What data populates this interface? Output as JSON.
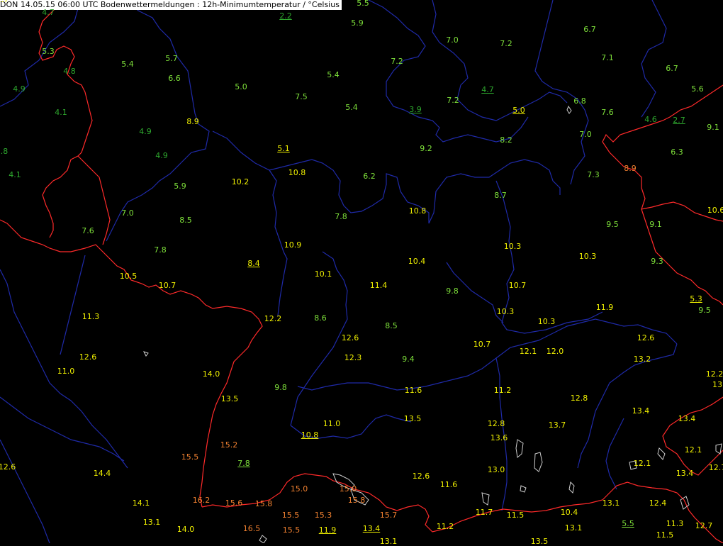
{
  "title": "DON 14.05.15 06:00 UTC  Bodenwettermeldungen :  12h-Minimumtemperatur / °Celsius",
  "colors": {
    "background": "#000000",
    "country_border": "#ff2a2a",
    "state_border": "#1f2aa8",
    "lake_outline": "#cfcfcf",
    "cold_dark": "#2ea82e",
    "cool": "#7ee03a",
    "mild": "#f0f000",
    "warm": "#f08030"
  },
  "stations": [
    {
      "v": "4.7",
      "cls": "cold_dark"
    },
    {
      "v": "5.5",
      "cls": "cool"
    },
    {
      "v": "2.2",
      "cls": "cold_dark",
      "u": true
    },
    {
      "v": "5.9",
      "cls": "cool"
    },
    {
      "v": "6.7",
      "cls": "cool"
    },
    {
      "v": "7.0",
      "cls": "cool"
    },
    {
      "v": "7.2",
      "cls": "cool"
    },
    {
      "v": "5.3",
      "cls": "cool"
    },
    {
      "v": "7.1",
      "cls": "cool"
    },
    {
      "v": "5.4",
      "cls": "cool"
    },
    {
      "v": "5.7",
      "cls": "cool"
    },
    {
      "v": "4.8",
      "cls": "cold_dark"
    },
    {
      "v": "7.2",
      "cls": "cool"
    },
    {
      "v": "6.7",
      "cls": "cool"
    },
    {
      "v": "6.6",
      "cls": "cool"
    },
    {
      "v": "5.4",
      "cls": "cool"
    },
    {
      "v": "4.9",
      "cls": "cold_dark"
    },
    {
      "v": "5.0",
      "cls": "cool"
    },
    {
      "v": "4.7",
      "cls": "cold_dark",
      "u": true
    },
    {
      "v": "5.6",
      "cls": "cool"
    },
    {
      "v": "7.5",
      "cls": "cool"
    },
    {
      "v": "6.8",
      "cls": "cool"
    },
    {
      "v": "7.2",
      "cls": "cool"
    },
    {
      "v": "4.1",
      "cls": "cold_dark"
    },
    {
      "v": "5.4",
      "cls": "cool"
    },
    {
      "v": "3.9",
      "cls": "cold_dark",
      "u": true
    },
    {
      "v": "5.0",
      "cls": "mild",
      "u": true
    },
    {
      "v": "7.6",
      "cls": "cool"
    },
    {
      "v": "4.6",
      "cls": "cold_dark"
    },
    {
      "v": "2.7",
      "cls": "cold_dark",
      "u": true
    },
    {
      "v": "8.9",
      "cls": "mild"
    },
    {
      "v": "9.1",
      "cls": "cool"
    },
    {
      "v": "4.9",
      "cls": "cold_dark"
    },
    {
      "v": "7.0",
      "cls": "cool"
    },
    {
      "v": "8.2",
      "cls": "cool"
    },
    {
      "v": "5.1",
      "cls": "mild",
      "u": true
    },
    {
      "v": "9.2",
      "cls": "cool"
    },
    {
      "v": ".8",
      "cls": "cold_dark"
    },
    {
      "v": "4.9",
      "cls": "cold_dark"
    },
    {
      "v": "6.3",
      "cls": "cool"
    },
    {
      "v": "8.9",
      "cls": "warm"
    },
    {
      "v": "10.8",
      "cls": "mild"
    },
    {
      "v": "4.1",
      "cls": "cold_dark"
    },
    {
      "v": "6.2",
      "cls": "cool"
    },
    {
      "v": "7.3",
      "cls": "cool"
    },
    {
      "v": "10.2",
      "cls": "mild"
    },
    {
      "v": "5.9",
      "cls": "cool"
    },
    {
      "v": "8.7",
      "cls": "cool"
    },
    {
      "v": "10.6",
      "cls": "mild"
    },
    {
      "v": "10.8",
      "cls": "mild"
    },
    {
      "v": "7.0",
      "cls": "cool"
    },
    {
      "v": "7.8",
      "cls": "cool"
    },
    {
      "v": "8.5",
      "cls": "cool"
    },
    {
      "v": "9.5",
      "cls": "cool"
    },
    {
      "v": "9.1",
      "cls": "cool"
    },
    {
      "v": "7.6",
      "cls": "cool"
    },
    {
      "v": "10.9",
      "cls": "mild"
    },
    {
      "v": "10.3",
      "cls": "mild"
    },
    {
      "v": "7.8",
      "cls": "cool"
    },
    {
      "v": "10.3",
      "cls": "mild"
    },
    {
      "v": "10.4",
      "cls": "mild"
    },
    {
      "v": "8.4",
      "cls": "mild",
      "u": true
    },
    {
      "v": "9.3",
      "cls": "cool"
    },
    {
      "v": "10.1",
      "cls": "mild"
    },
    {
      "v": "10.5",
      "cls": "mild"
    },
    {
      "v": "10.7",
      "cls": "mild"
    },
    {
      "v": "11.4",
      "cls": "mild"
    },
    {
      "v": "10.7",
      "cls": "mild"
    },
    {
      "v": "9.8",
      "cls": "cool"
    },
    {
      "v": "5.3",
      "cls": "mild",
      "u": true
    },
    {
      "v": "11.9",
      "cls": "mild"
    },
    {
      "v": "11.3",
      "cls": "mild"
    },
    {
      "v": "10.3",
      "cls": "mild"
    },
    {
      "v": "9.5",
      "cls": "cool"
    },
    {
      "v": "12.2",
      "cls": "mild"
    },
    {
      "v": "8.6",
      "cls": "cool"
    },
    {
      "v": "10.3",
      "cls": "mild"
    },
    {
      "v": "8.5",
      "cls": "cool"
    },
    {
      "v": "12.6",
      "cls": "mild"
    },
    {
      "v": "10.7",
      "cls": "mild"
    },
    {
      "v": "12.6",
      "cls": "mild"
    },
    {
      "v": "12.1",
      "cls": "mild"
    },
    {
      "v": "12.0",
      "cls": "mild"
    },
    {
      "v": "12.3",
      "cls": "mild"
    },
    {
      "v": "9.4",
      "cls": "cool"
    },
    {
      "v": "12.6",
      "cls": "mild"
    },
    {
      "v": "13.2",
      "cls": "mild"
    },
    {
      "v": "11.0",
      "cls": "mild"
    },
    {
      "v": "14.0",
      "cls": "mild"
    },
    {
      "v": "12.2",
      "cls": "mild"
    },
    {
      "v": "13",
      "cls": "mild"
    },
    {
      "v": "9.8",
      "cls": "cool"
    },
    {
      "v": "11.6",
      "cls": "mild"
    },
    {
      "v": "11.2",
      "cls": "mild"
    },
    {
      "v": "13.5",
      "cls": "mild"
    },
    {
      "v": "12.8",
      "cls": "mild"
    },
    {
      "v": "13.4",
      "cls": "mild"
    },
    {
      "v": "13.5",
      "cls": "mild"
    },
    {
      "v": "11.0",
      "cls": "mild"
    },
    {
      "v": "13.4",
      "cls": "mild"
    },
    {
      "v": "12.8",
      "cls": "mild"
    },
    {
      "v": "13.7",
      "cls": "mild"
    },
    {
      "v": "10.8",
      "cls": "mild",
      "u": true
    },
    {
      "v": "13.6",
      "cls": "mild"
    },
    {
      "v": "15.2",
      "cls": "warm"
    },
    {
      "v": "12.6",
      "cls": "mild"
    },
    {
      "v": "15.5",
      "cls": "warm"
    },
    {
      "v": "12.1",
      "cls": "mild"
    },
    {
      "v": "7.8",
      "cls": "cool",
      "u": true
    },
    {
      "v": "12.1",
      "cls": "mild"
    },
    {
      "v": "13.0",
      "cls": "mild"
    },
    {
      "v": "12.7",
      "cls": "mild"
    },
    {
      "v": "14.4",
      "cls": "mild"
    },
    {
      "v": "12.6",
      "cls": "mild"
    },
    {
      "v": "13.4",
      "cls": "mild"
    },
    {
      "v": "11.6",
      "cls": "mild"
    },
    {
      "v": "15.0",
      "cls": "warm"
    },
    {
      "v": "15.0",
      "cls": "warm"
    },
    {
      "v": "16.2",
      "cls": "warm"
    },
    {
      "v": "15.8",
      "cls": "warm"
    },
    {
      "v": "14.1",
      "cls": "mild"
    },
    {
      "v": "15.6",
      "cls": "warm"
    },
    {
      "v": "15.8",
      "cls": "warm"
    },
    {
      "v": "13.1",
      "cls": "mild"
    },
    {
      "v": "12.4",
      "cls": "mild"
    },
    {
      "v": "11.7",
      "cls": "mild"
    },
    {
      "v": "11.5",
      "cls": "mild"
    },
    {
      "v": "10.4",
      "cls": "mild"
    },
    {
      "v": "15.5",
      "cls": "warm"
    },
    {
      "v": "15.3",
      "cls": "warm"
    },
    {
      "v": "15.7",
      "cls": "warm"
    },
    {
      "v": "13.1",
      "cls": "mild"
    },
    {
      "v": "5.5",
      "cls": "cool",
      "u": true
    },
    {
      "v": "11.3",
      "cls": "mild"
    },
    {
      "v": "11.2",
      "cls": "mild"
    },
    {
      "v": "13.1",
      "cls": "mild"
    },
    {
      "v": "12.7",
      "cls": "mild"
    },
    {
      "v": "14.0",
      "cls": "mild"
    },
    {
      "v": "16.5",
      "cls": "warm"
    },
    {
      "v": "15.5",
      "cls": "warm"
    },
    {
      "v": "11.9",
      "cls": "mild",
      "u": true
    },
    {
      "v": "13.4",
      "cls": "mild",
      "u": true
    },
    {
      "v": "13.1",
      "cls": "mild"
    },
    {
      "v": "11.5",
      "cls": "mild"
    },
    {
      "v": "13.5",
      "cls": "mild"
    },
    {
      "v": "12.7",
      "cls": "mild"
    }
  ]
}
